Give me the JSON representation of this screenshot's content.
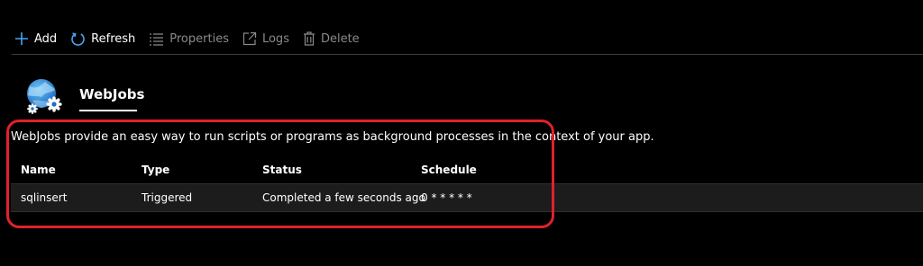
{
  "toolbar": {
    "add": {
      "label": "Add",
      "icon": "plus-icon",
      "enabled": true
    },
    "refresh": {
      "label": "Refresh",
      "icon": "refresh-icon",
      "enabled": true
    },
    "properties": {
      "label": "Properties",
      "icon": "properties-icon",
      "enabled": false
    },
    "logs": {
      "label": "Logs",
      "icon": "external-link-icon",
      "enabled": false
    },
    "delete": {
      "label": "Delete",
      "icon": "trash-icon",
      "enabled": false
    }
  },
  "header": {
    "icon": "webjobs-icon",
    "title": "WebJobs"
  },
  "description": "WebJobs provide an easy way to run scripts or programs as background processes in the context of your app.",
  "table": {
    "columns": [
      "Name",
      "Type",
      "Status",
      "Schedule"
    ],
    "rows": [
      {
        "name": "sqlinsert",
        "type": "Triggered",
        "status": "Completed a few seconds ago",
        "schedule": "0 * * * * *"
      }
    ]
  },
  "colors": {
    "accent": "#0078d4",
    "highlight": "#e0212e",
    "background": "#000000",
    "disabled_text": "#8a8a8a"
  }
}
